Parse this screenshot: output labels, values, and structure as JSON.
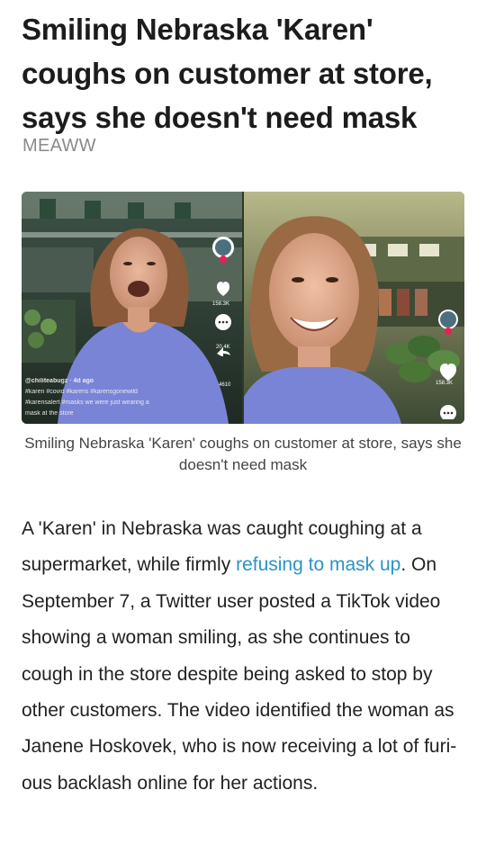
{
  "article": {
    "headline": "Smiling Nebraska 'Karen' coughs on customer at store, says she doesn't need mask",
    "source": "MEAWW",
    "image_caption": "Smiling Nebraska 'Karen' coughs on customer at store, says she doesn't need mask",
    "body": {
      "part1": "A 'Karen' in Nebraska was caught coughing at a supermarket, while firmly ",
      "link_text": "refusing to mask up",
      "part2": ". On September 7, a Twitter user posted a TikTok video showing a woman smiling, as she continues to cough in the store despite being asked to stop by other customers. The video identified the woman as Janene Hoskovek, who is now receiving a lot of furi-ous backlash online for her actions."
    }
  },
  "tiktok_left": {
    "user": "@chiliteabugz · 4d ago",
    "tags_line1": "#karen #covid #karens #karensgonewild",
    "tags_line2": "#karensalert #masks we were just wearing a",
    "tags_line3": "mask at the store",
    "likes": "158.3K",
    "comments": "20.4K",
    "shares": "4610"
  },
  "tiktok_right": {
    "likes": "158.3K"
  },
  "colors": {
    "link": "#2a93c9",
    "headline": "#1c1c1c",
    "source": "#8a8a8a",
    "shirt": "#7a84d6"
  }
}
